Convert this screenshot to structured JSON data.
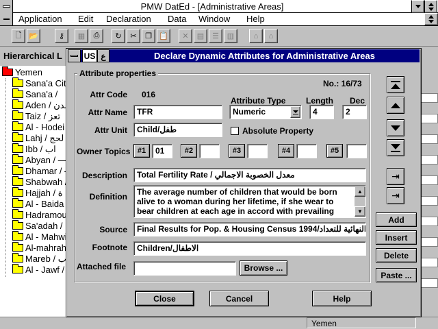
{
  "app": {
    "title": "PMW DatEd - [Administrative Areas]",
    "menu": [
      "Application",
      "Edit",
      "Declaration",
      "Data",
      "Window",
      "Help"
    ],
    "panel_header": "Hierarchical L",
    "status_region": "Yemen"
  },
  "tree": {
    "root": "Yemen",
    "items": [
      "Sana'a Cit",
      "Sana'a / ",
      "Aden / عدن",
      "Taiz / تعز",
      "Al - Hodei",
      "Lahj / لحج",
      "Ibb / اب",
      "Abyan / —",
      "Dhamar / —",
      "Shabwah / ",
      "Hajjah / ة",
      "Al - Baida",
      "Hadramou",
      "Sa'adah / ",
      "Al - Mahwi",
      "Al-mahrah",
      "Mareb / ب",
      "Al - Jawf / "
    ]
  },
  "dialog": {
    "title": "Declare Dynamic Attributes for Administrative Areas",
    "lang_us": "US",
    "lang_ar": "ع",
    "group_label": "Attribute properties",
    "record_no": "No.: 16/73",
    "attr_code_label": "Attr Code",
    "attr_code": "016",
    "attr_name_label": "Attr Name",
    "attr_name": "TFR",
    "attr_unit_label": "Attr Unit",
    "attr_unit": "Child/طفل",
    "attr_type_label": "Attribute Type",
    "attr_type": "Numeric",
    "length_label": "Length",
    "length": "4",
    "dec_label": "Dec",
    "dec": "2",
    "absolute_label": "Absolute Property",
    "owner_topics_label": "Owner Topics",
    "topics": [
      {
        "label": "#1",
        "value": "01"
      },
      {
        "label": "#2",
        "value": ""
      },
      {
        "label": "#3",
        "value": ""
      },
      {
        "label": "#4",
        "value": ""
      },
      {
        "label": "#5",
        "value": ""
      }
    ],
    "description_label": "Description",
    "description": "Total Fertility Rate /  معدل الخصوبة الاجمالي",
    "definition_label": "Definition",
    "definition_lines": [
      "The average number of children that would be born",
      "alive to a woman during her lifetime, if she wear to",
      "bear children at each age in accord with prevailing"
    ],
    "source_label": "Source",
    "source": "Final Results for Pop. & Housing Census 1994/ج النهائية للتعداد",
    "footnote_label": "Footnote",
    "footnote": "Children/الاطفال",
    "attached_label": "Attached file",
    "attached": "",
    "browse": "Browse ...",
    "add": "Add",
    "insert": "Insert",
    "delete": "Delete",
    "paste": "Paste ...",
    "close": "Close",
    "cancel": "Cancel",
    "help": "Help"
  }
}
